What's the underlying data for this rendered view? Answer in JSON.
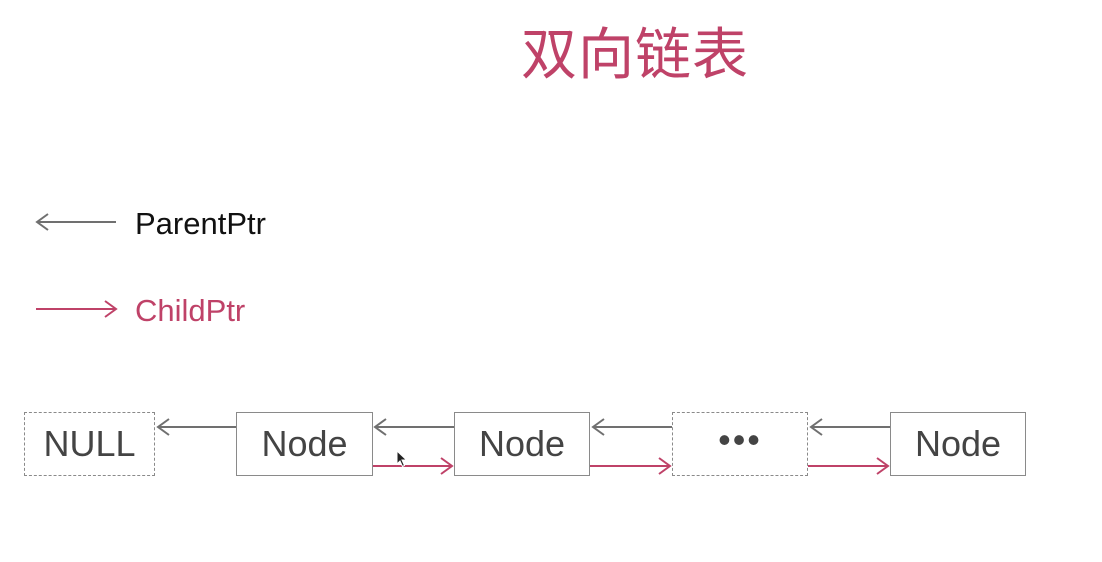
{
  "title": "双向链表",
  "legend": {
    "parent_label": "ParentPtr",
    "child_label": "ChildPtr"
  },
  "nodes": [
    {
      "label": "NULL",
      "style": "dashed"
    },
    {
      "label": "Node",
      "style": "solid"
    },
    {
      "label": "Node",
      "style": "solid"
    },
    {
      "label": "•••",
      "style": "dashed"
    },
    {
      "label": "Node",
      "style": "solid"
    }
  ],
  "colors": {
    "parent_ptr": "#707070",
    "child_ptr": "#bf4268",
    "title": "#bf4268"
  }
}
